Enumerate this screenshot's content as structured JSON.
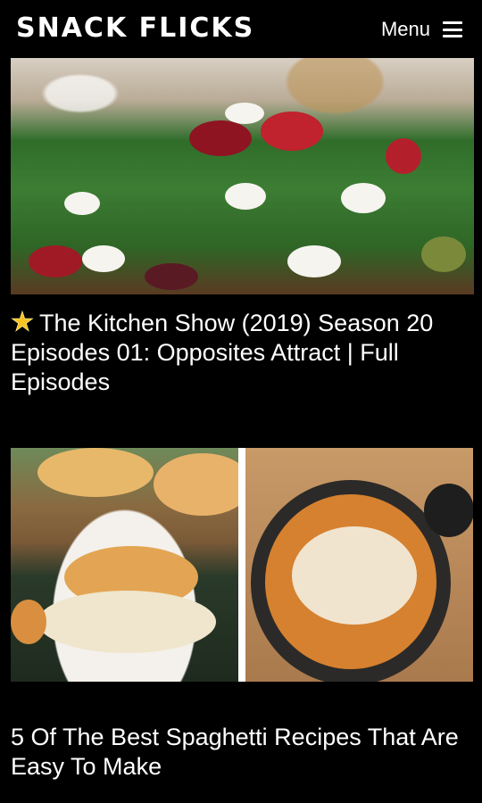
{
  "header": {
    "logo": "SNACK FLICKS",
    "menu_label": "Menu"
  },
  "icons": {
    "menu": "hamburger-icon",
    "star": "star-emoji-icon"
  },
  "articles": [
    {
      "title": "The Kitchen Show (2019) Season 20 Episodes 01: Opposites Attract | Full Episodes"
    },
    {
      "title": "5 Of The Best Spaghetti Recipes That Are Easy To Make"
    }
  ],
  "colors": {
    "background": "#000000",
    "text": "#ffffff",
    "star": "#f7c325"
  }
}
